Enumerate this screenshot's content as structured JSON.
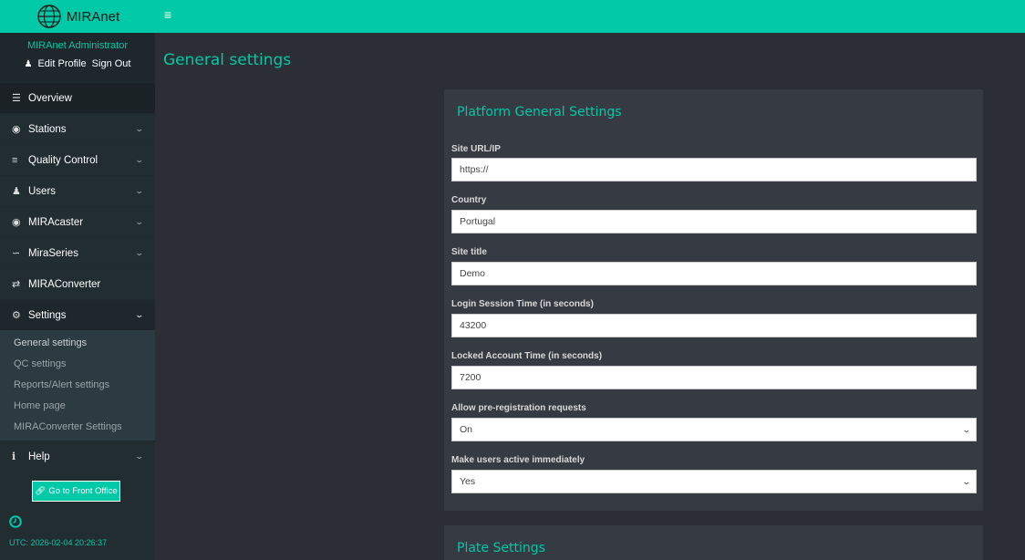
{
  "brand": {
    "name": "MIRAnet"
  },
  "user": {
    "name": "MIRAnet Administrator",
    "edit_profile": "Edit Profile",
    "sign_out": "Sign Out"
  },
  "menu": {
    "overview": "Overview",
    "stations": "Stations",
    "quality_control": "Quality Control",
    "users": "Users",
    "miracaster": "MIRAcaster",
    "miraseries": "MiraSeries",
    "miraconverter": "MIRAConverter",
    "settings": "Settings",
    "settings_items": [
      "General settings",
      "QC settings",
      "Reports/Alert settings",
      "Home page",
      "MIRAConverter Settings"
    ],
    "help": "Help"
  },
  "front_office_button": "Go to Front Office",
  "utc_time": "UTC: 2026-02-04 20:26:37",
  "page_title": "General settings",
  "platform_card": {
    "title": "Platform General Settings",
    "fields": [
      {
        "label": "Site URL/IP",
        "value": "https://"
      },
      {
        "label": "Country",
        "value": "Portugal"
      },
      {
        "label": "Site title",
        "value": "Demo"
      },
      {
        "label": "Login Session Time (in seconds)",
        "value": "43200"
      },
      {
        "label": "Locked Account Time (in seconds)",
        "value": "7200"
      },
      {
        "label": "Allow pre-registration requests",
        "value": "On"
      },
      {
        "label": "Make users active immediately",
        "value": "Yes"
      }
    ]
  },
  "plate_card": {
    "title": "Plate Settings"
  },
  "colors": {
    "accent": "#00c9a7",
    "sidebar": "#222d32",
    "background": "#2b2e35",
    "card": "#363a43"
  }
}
